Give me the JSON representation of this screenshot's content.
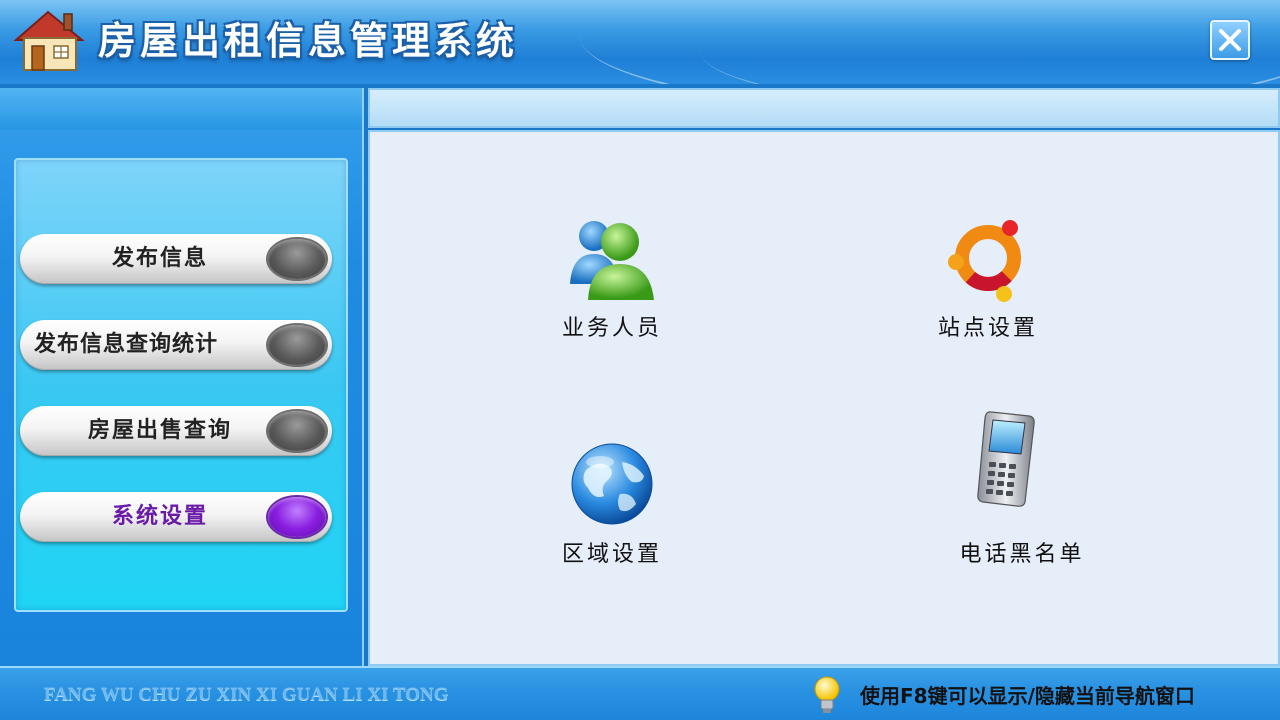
{
  "window": {
    "title": "房屋出租信息管理系统"
  },
  "nav": {
    "items": [
      {
        "label": "发布信息",
        "active": false
      },
      {
        "label": "发布信息查询统计",
        "active": false
      },
      {
        "label": "房屋出售查询",
        "active": false
      },
      {
        "label": "系统设置",
        "active": true
      }
    ]
  },
  "content": {
    "tiles": [
      {
        "label": "业务人员",
        "icon": "users-icon"
      },
      {
        "label": "站点设置",
        "icon": "site-icon"
      },
      {
        "label": "区域设置",
        "icon": "globe-icon"
      },
      {
        "label": "电话黑名单",
        "icon": "mobile-phone-icon"
      }
    ]
  },
  "status": {
    "pinyin": "FANG WU CHU ZU XIN XI GUAN LI XI TONG",
    "hint": "使用F8键可以显示/隐藏当前导航窗口"
  },
  "colors": {
    "titlebar": "#1e7fd6",
    "nav_panel": "#3ac8f2",
    "content_bg": "#e6eefa",
    "active_knob": "#8a1ee0",
    "active_label": "#6a1aa8"
  }
}
